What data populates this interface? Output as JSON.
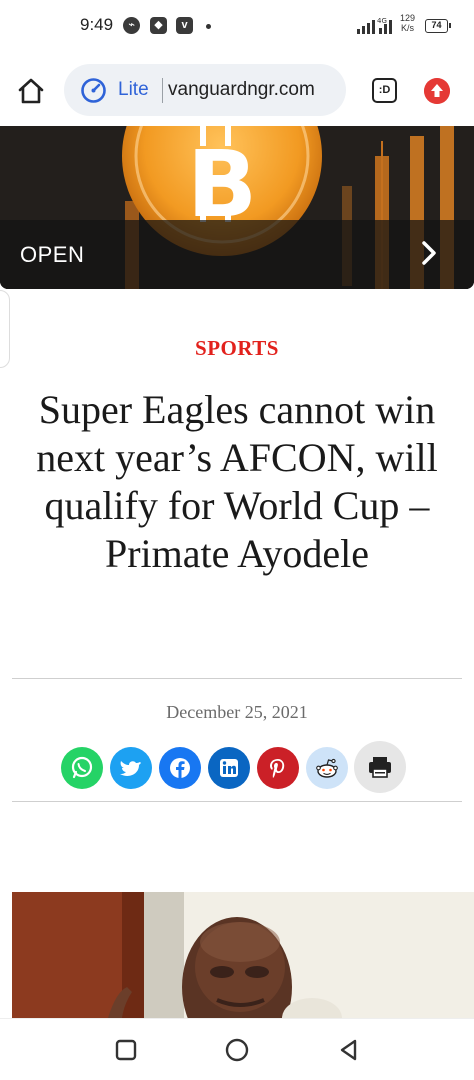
{
  "status_bar": {
    "time": "9:49",
    "notification_icons": [
      "messenger-icon",
      "app-icon",
      "vpn-icon"
    ],
    "network": "4G",
    "speed_value": "129",
    "speed_unit": "K/s",
    "battery": "74"
  },
  "browser": {
    "mode_label": "Lite",
    "url": "vanguardngr.com",
    "tabs_label": ":D",
    "colors": {
      "lite_blue": "#2f63d8",
      "update_red": "#e53935"
    }
  },
  "ad": {
    "cta_label": "OPEN"
  },
  "article": {
    "category": "SPORTS",
    "headline": "Super Eagles cannot win next year’s AFCON, will qualify for World Cup – Primate Ayodele",
    "date": "December 25, 2021",
    "category_color": "#e2211c"
  },
  "share": {
    "buttons": [
      {
        "name": "whatsapp",
        "color": "#25d366"
      },
      {
        "name": "twitter",
        "color": "#1da1f2"
      },
      {
        "name": "facebook",
        "color": "#1877f2"
      },
      {
        "name": "linkedin",
        "color": "#0a66c2"
      },
      {
        "name": "pinterest",
        "color": "#cb2027"
      },
      {
        "name": "reddit",
        "color": "#cee3f8"
      },
      {
        "name": "print",
        "color": "#e6e6e6"
      }
    ]
  },
  "nav": {
    "buttons": [
      "recents",
      "home",
      "back"
    ]
  }
}
